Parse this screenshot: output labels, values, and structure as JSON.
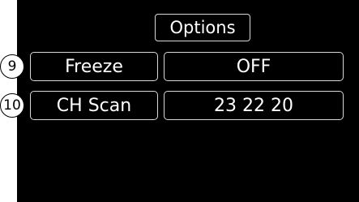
{
  "title": "Options",
  "rows": [
    {
      "callout": "9",
      "label": "Freeze",
      "value": "OFF"
    },
    {
      "callout": "10",
      "label": "CH Scan",
      "value": "23 22 20"
    }
  ]
}
